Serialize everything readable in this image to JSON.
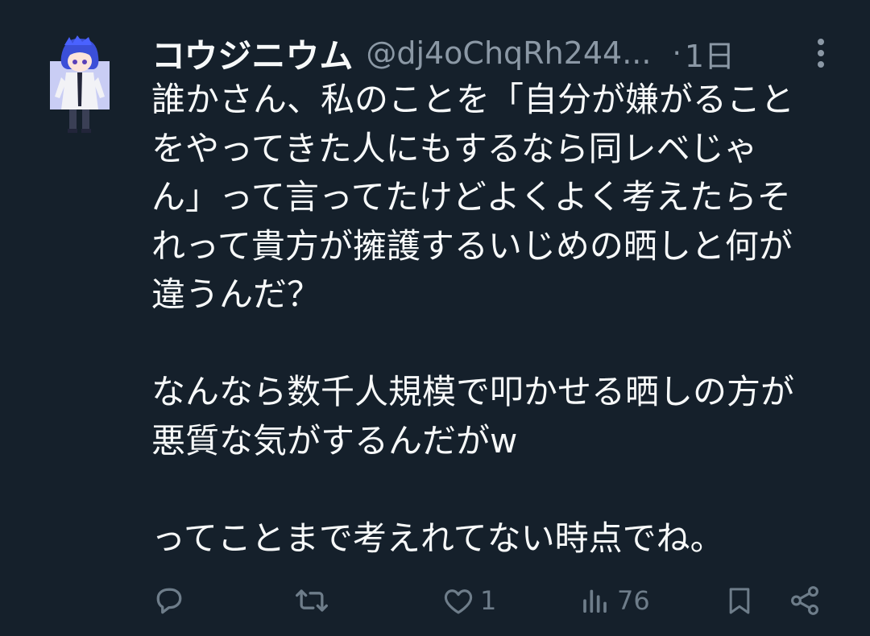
{
  "tweet": {
    "display_name": "コウジニウム",
    "handle": "@dj4oChqRh244...",
    "separator": "·",
    "time": "1日",
    "paragraphs": [
      "誰かさん、私のことを「自分が嫌がること\nをやってきた人にもするなら同レベじゃ\nん」って言ってたけどよくよく考えたらそ\nれって貴方が擁護するいじめの晒しと何が\n違うんだ？",
      "なんなら数千人規模で叩かせる晒しの方が\n悪質な気がするんだがw",
      "ってことまで考えれてない時点でね。"
    ]
  },
  "actions": {
    "reply_count": "",
    "retweet_count": "",
    "like_count": "1",
    "views_count": "76"
  },
  "colors": {
    "background": "#15202b",
    "text_primary": "#f7f9f9",
    "text_secondary": "#8b98a5",
    "icon_muted": "#6e7d8a"
  },
  "icons": {
    "reply": "reply-icon",
    "retweet": "retweet-icon",
    "like": "heart-icon",
    "views": "views-icon",
    "bookmark": "bookmark-icon",
    "share": "share-icon",
    "more": "more-vertical-icon"
  }
}
